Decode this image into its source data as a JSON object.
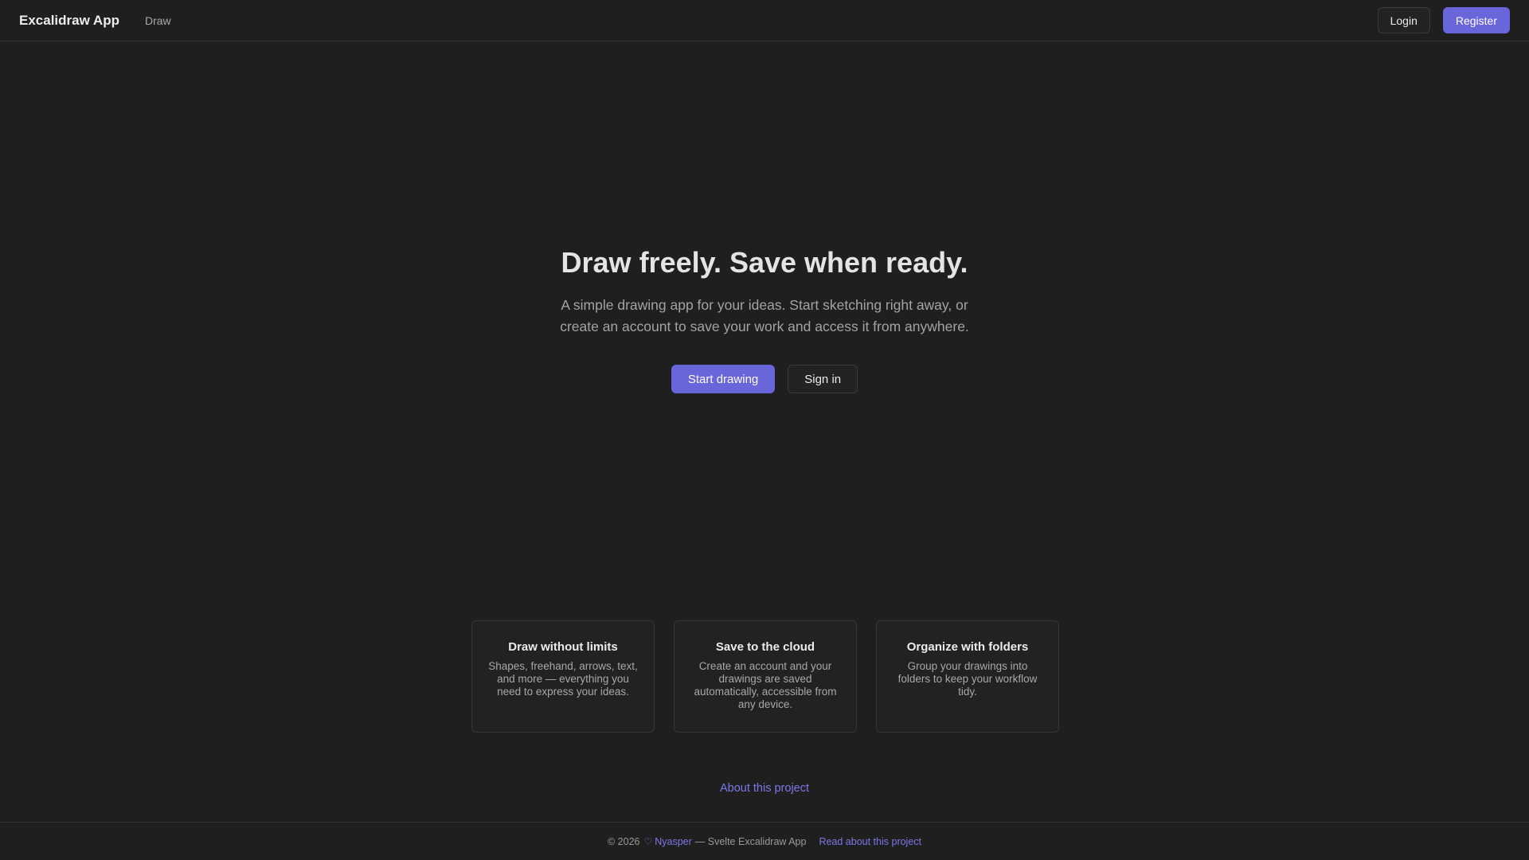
{
  "header": {
    "brand": "Excalidraw App",
    "nav": [
      {
        "label": "Draw"
      }
    ],
    "login_label": "Login",
    "register_label": "Register"
  },
  "hero": {
    "title": "Draw freely. Save when ready.",
    "subtitle": "A simple drawing app for your ideas. Start sketching right away, or create an account to save your work and access it from anywhere.",
    "start_label": "Start drawing",
    "signin_label": "Sign in"
  },
  "features": [
    {
      "title": "Draw without limits",
      "desc": "Shapes, freehand, arrows, text, and more — everything you need to express your ideas."
    },
    {
      "title": "Save to the cloud",
      "desc": "Create an account and your drawings are saved automatically, accessible from any device."
    },
    {
      "title": "Organize with folders",
      "desc": "Group your drawings into folders to keep your workflow tidy."
    }
  ],
  "about_link": "About this project",
  "footer": {
    "copyright": "© 2026",
    "author": "Nyasper",
    "tagline": "— Svelte Excalidraw App",
    "read_link": "Read about this project",
    "author_icon": "heart-icon"
  },
  "colors": {
    "accent": "#6965db",
    "link": "#7c78e8",
    "background": "#1f1f1f"
  }
}
